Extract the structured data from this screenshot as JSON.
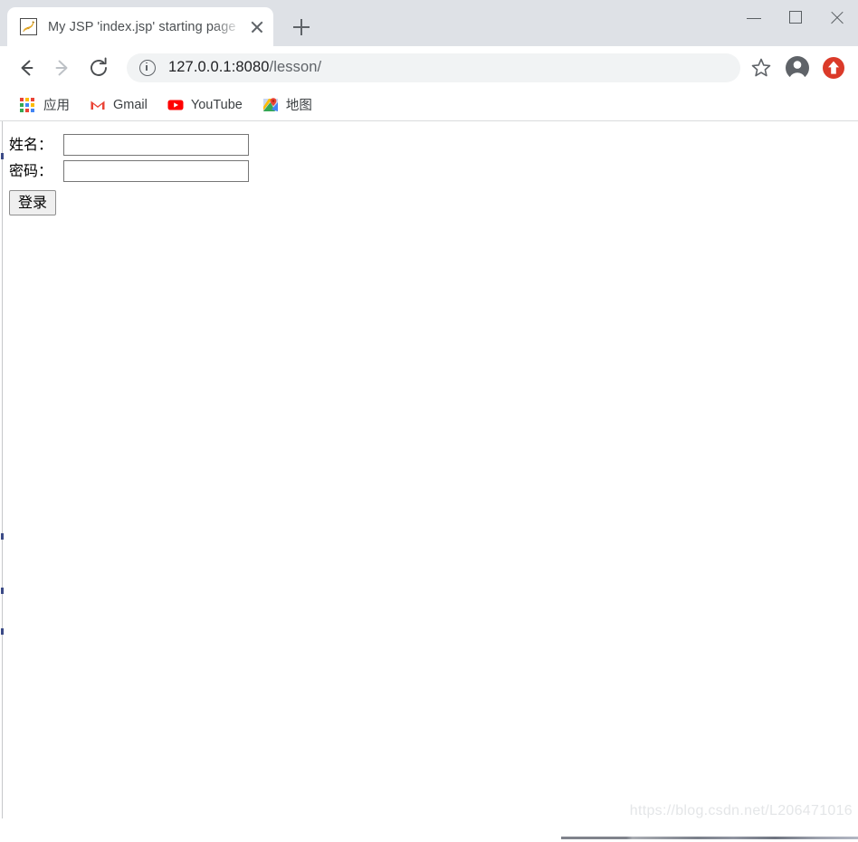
{
  "window": {
    "controls": {
      "minimize": "minimize",
      "maximize": "maximize",
      "close": "close"
    }
  },
  "tab_strip": {
    "tabs": [
      {
        "title": "My JSP 'index.jsp' starting page",
        "favicon": "tomcat-cat-icon",
        "active": true
      }
    ],
    "new_tab_label": "+"
  },
  "toolbar": {
    "back_icon": "back-arrow-icon",
    "forward_icon": "forward-arrow-icon",
    "reload_icon": "reload-icon",
    "security_icon": "info-circle-icon",
    "url_host": "127.0.0.1:8080",
    "url_path": "/lesson/",
    "url_full": "127.0.0.1:8080/lesson/",
    "bookmark_icon": "star-icon",
    "profile_icon": "profile-avatar-icon",
    "update_icon": "update-arrow-icon",
    "colors": {
      "update_red": "#db3a29",
      "omnibox_bg": "#f1f3f4",
      "tabstrip_bg": "#dee1e6"
    }
  },
  "bookmarks_bar": {
    "items": [
      {
        "label": "应用",
        "icon": "apps-grid-icon"
      },
      {
        "label": "Gmail",
        "icon": "gmail-icon"
      },
      {
        "label": "YouTube",
        "icon": "youtube-icon"
      },
      {
        "label": "地图",
        "icon": "google-maps-icon"
      }
    ]
  },
  "page": {
    "form": {
      "name_label": "姓名：",
      "name_value": "",
      "name_placeholder": "",
      "password_label": "密码：",
      "password_value": "",
      "password_placeholder": "",
      "submit_label": "登录"
    },
    "watermark": "https://blog.csdn.net/L206471016"
  }
}
